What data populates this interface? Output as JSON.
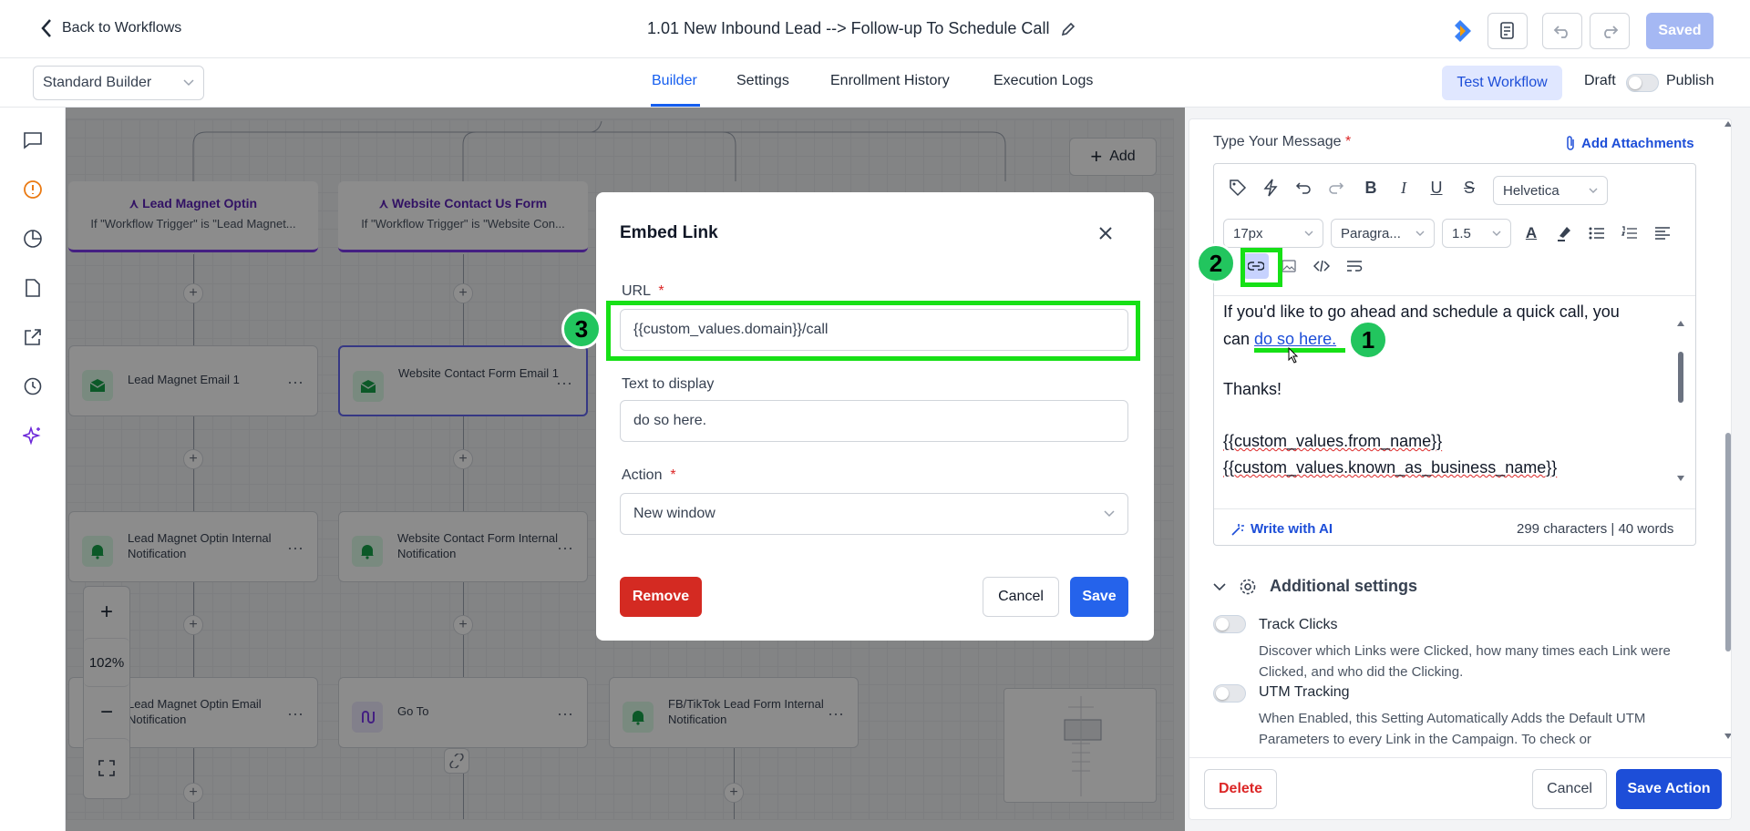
{
  "topbar": {
    "back_label": "Back to Workflows",
    "workflow_title": "1.01 New Inbound Lead --> Follow-up To Schedule Call",
    "saved_label": "Saved"
  },
  "subbar": {
    "builder_select": "Standard Builder",
    "tabs": [
      {
        "label": "Builder",
        "active": true
      },
      {
        "label": "Settings",
        "active": false
      },
      {
        "label": "Enrollment History",
        "active": false
      },
      {
        "label": "Execution Logs",
        "active": false
      }
    ],
    "test_workflow": "Test Workflow",
    "draft_label": "Draft",
    "publish_label": "Publish"
  },
  "canvas": {
    "add_label": "Add",
    "zoom": "102%",
    "triggers": [
      {
        "title": "Lead Magnet Optin",
        "subtitle": "If \"Workflow Trigger\" is \"Lead Magnet..."
      },
      {
        "title": "Website Contact Us Form",
        "subtitle": "If \"Workflow Trigger\" is \"Website Con..."
      }
    ],
    "nodes": [
      {
        "label": "Lead Magnet Email 1"
      },
      {
        "label": "Website Contact Form Email 1"
      },
      {
        "label": "Lead Magnet Optin Internal Notification"
      },
      {
        "label": "Website Contact Form Internal Notification"
      },
      {
        "label": "Lead Magnet Optin Email Notification"
      },
      {
        "label": "Go To"
      },
      {
        "label": "FB/TikTok Lead Form Internal Notification"
      }
    ]
  },
  "modal": {
    "title": "Embed Link",
    "url_label": "URL",
    "url_value": "{{custom_values.domain}}/call",
    "text_label": "Text to display",
    "text_value": "do so here.",
    "action_label": "Action",
    "action_value": "New window",
    "remove_label": "Remove",
    "cancel_label": "Cancel",
    "save_label": "Save",
    "required_mark": "*"
  },
  "panel": {
    "message_label": "Type Your Message",
    "attachments_label": "Add Attachments",
    "font_family": "Helvetica",
    "font_size": "17px",
    "paragraph": "Paragra...",
    "line_height": "1.5",
    "body": {
      "line1": "If you'd like to go ahead and schedule a quick call, you",
      "line2_prefix": "can ",
      "link_text": "do so here.",
      "thanks": "Thanks!",
      "from_name": "{{custom_values.from_name}}",
      "business_name": "{{custom_values.known_as_business_name}}"
    },
    "write_ai": "Write with AI",
    "counts": "299 characters | 40 words",
    "additional_settings": "Additional settings",
    "track_clicks_title": "Track Clicks",
    "track_clicks_desc": "Discover which Links were Clicked, how many times each Link were Clicked, and who did the Clicking.",
    "utm_title": "UTM Tracking",
    "utm_desc": "When Enabled, this Setting Automatically Adds the Default UTM Parameters to every Link in the Campaign. To check or",
    "delete_label": "Delete",
    "cancel_label": "Cancel",
    "save_action_label": "Save Action"
  },
  "annotations": [
    "1",
    "2",
    "3"
  ],
  "colors": {
    "primary": "#155eef",
    "trigger_purple": "#7c3aed",
    "annotation_green": "#22c55e",
    "danger": "#dc2626"
  }
}
